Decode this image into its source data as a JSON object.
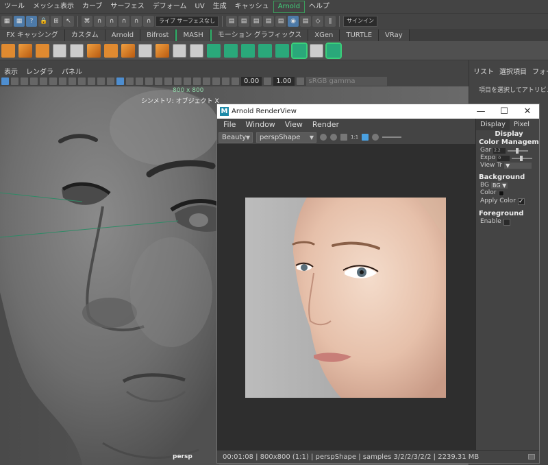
{
  "maya": {
    "menu": [
      "ツール",
      "メッシュ表示",
      "カーブ",
      "サーフェス",
      "デフォーム",
      "UV",
      "生成",
      "キャッシュ",
      "Arnold",
      "ヘルプ"
    ],
    "menu_active_index": 8,
    "status": {
      "surface_label": "ライブ サーフェスなし",
      "signin": "サインイン"
    },
    "shelf_tabs": [
      "FX キャッシング",
      "カスタム",
      "Arnold",
      "Bifrost",
      "MASH",
      "モーション グラフィックス",
      "XGen",
      "TURTLE",
      "VRay"
    ],
    "viewport_menu": [
      "表示",
      "レンダラ",
      "パネル"
    ],
    "viewport_toolbar": {
      "field1": "0.00",
      "field2": "1.00",
      "gamma": "sRGB gamma"
    },
    "viewport": {
      "resolution": "800 x 800",
      "symmetry": "シンメトリ: オブジェクト X",
      "camera": "persp"
    },
    "attr": {
      "tabs": [
        "リスト",
        "選択項目",
        "フォーカス"
      ],
      "message": "項目を選択してアトリビュート"
    }
  },
  "renderview": {
    "title": "Arnold RenderView",
    "logo_letter": "M",
    "window_controls": [
      "—",
      "☐",
      "✕"
    ],
    "menu": [
      "File",
      "Window",
      "View",
      "Render"
    ],
    "aov": "Beauty",
    "camera": "perspShape",
    "ratio_label": "1:1",
    "side_tabs": [
      "Display",
      "Pixel"
    ],
    "side_header": "Display",
    "color_management": {
      "title": "Color Managemen",
      "gamma_label": "Gar",
      "gamma_value": "2.2",
      "exposure_label": "Expo",
      "exposure_value": "0",
      "view_label": "View Tr"
    },
    "background": {
      "title": "Background",
      "bg_label": "BG",
      "bg_value": "BG",
      "color_label": "Color",
      "apply_label": "Apply Color",
      "apply_checked": "✓"
    },
    "foreground": {
      "title": "Foreground",
      "enable_label": "Enable"
    },
    "status": "00:01:08 | 800x800 (1:1) | perspShape | samples 3/2/2/3/2/2 | 2239.31 MB"
  }
}
